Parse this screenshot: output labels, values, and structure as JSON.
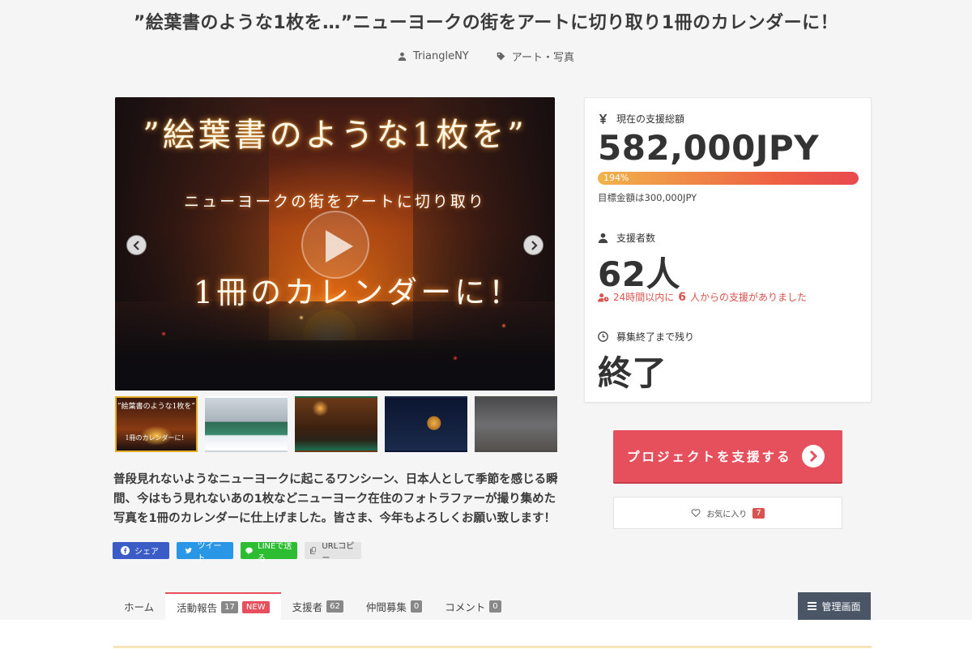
{
  "header": {
    "title": "”絵葉書のような1枚を…”ニューヨークの街をアートに切り取り1冊のカレンダーに！",
    "author": "TriangleNY",
    "category": "アート・写真"
  },
  "hero": {
    "line1": "”絵葉書のような1枚を”",
    "line2": "ニューヨークの街をアートに切り取り",
    "line3": "1冊のカレンダーに！"
  },
  "thumbs": {
    "t1_line1": "”絵葉書のような1枚を”",
    "t1_line3": "1冊のカレンダーに！"
  },
  "description": "普段見れないようなニューヨークに起こるワンシーン、日本人として季節を感じる瞬間、今はもう見れないあの1枚などニューヨーク在住のフォトラファーが撮り集めた写真を1冊のカレンダーに仕上げました。皆さま、今年もよろしくお願い致します！",
  "share": {
    "facebook": "シェア",
    "twitter": "ツイート",
    "line": "LINEで送る",
    "url": "URLコピー"
  },
  "stats": {
    "amount_label": "現在の支援総額",
    "amount": "582,000JPY",
    "percent_text": "194%",
    "percent": 194,
    "goal": "目標金額は300,000JPY",
    "supporters_label": "支援者数",
    "supporters": "62人",
    "recent_prefix": "24時間以内に",
    "recent_count": "6",
    "recent_suffix": "人からの支援がありました",
    "remaining_label": "募集終了まで残り",
    "remaining": "終了"
  },
  "actions": {
    "support": "プロジェクトを支援する",
    "favorite": "お気に入り",
    "favorite_count": "7"
  },
  "tabs": [
    {
      "label": "ホーム"
    },
    {
      "label": "活動報告",
      "count": "17",
      "badge": "NEW"
    },
    {
      "label": "支援者",
      "count": "62"
    },
    {
      "label": "仲間募集",
      "count": "0"
    },
    {
      "label": "コメント",
      "count": "0"
    }
  ],
  "admin": "管理画面",
  "colors": {
    "accent": "#e5505c",
    "thumb_active": "#e3ad2a",
    "facebook": "#3b5cc6",
    "twitter": "#2a96e6",
    "line": "#2dbd33"
  }
}
